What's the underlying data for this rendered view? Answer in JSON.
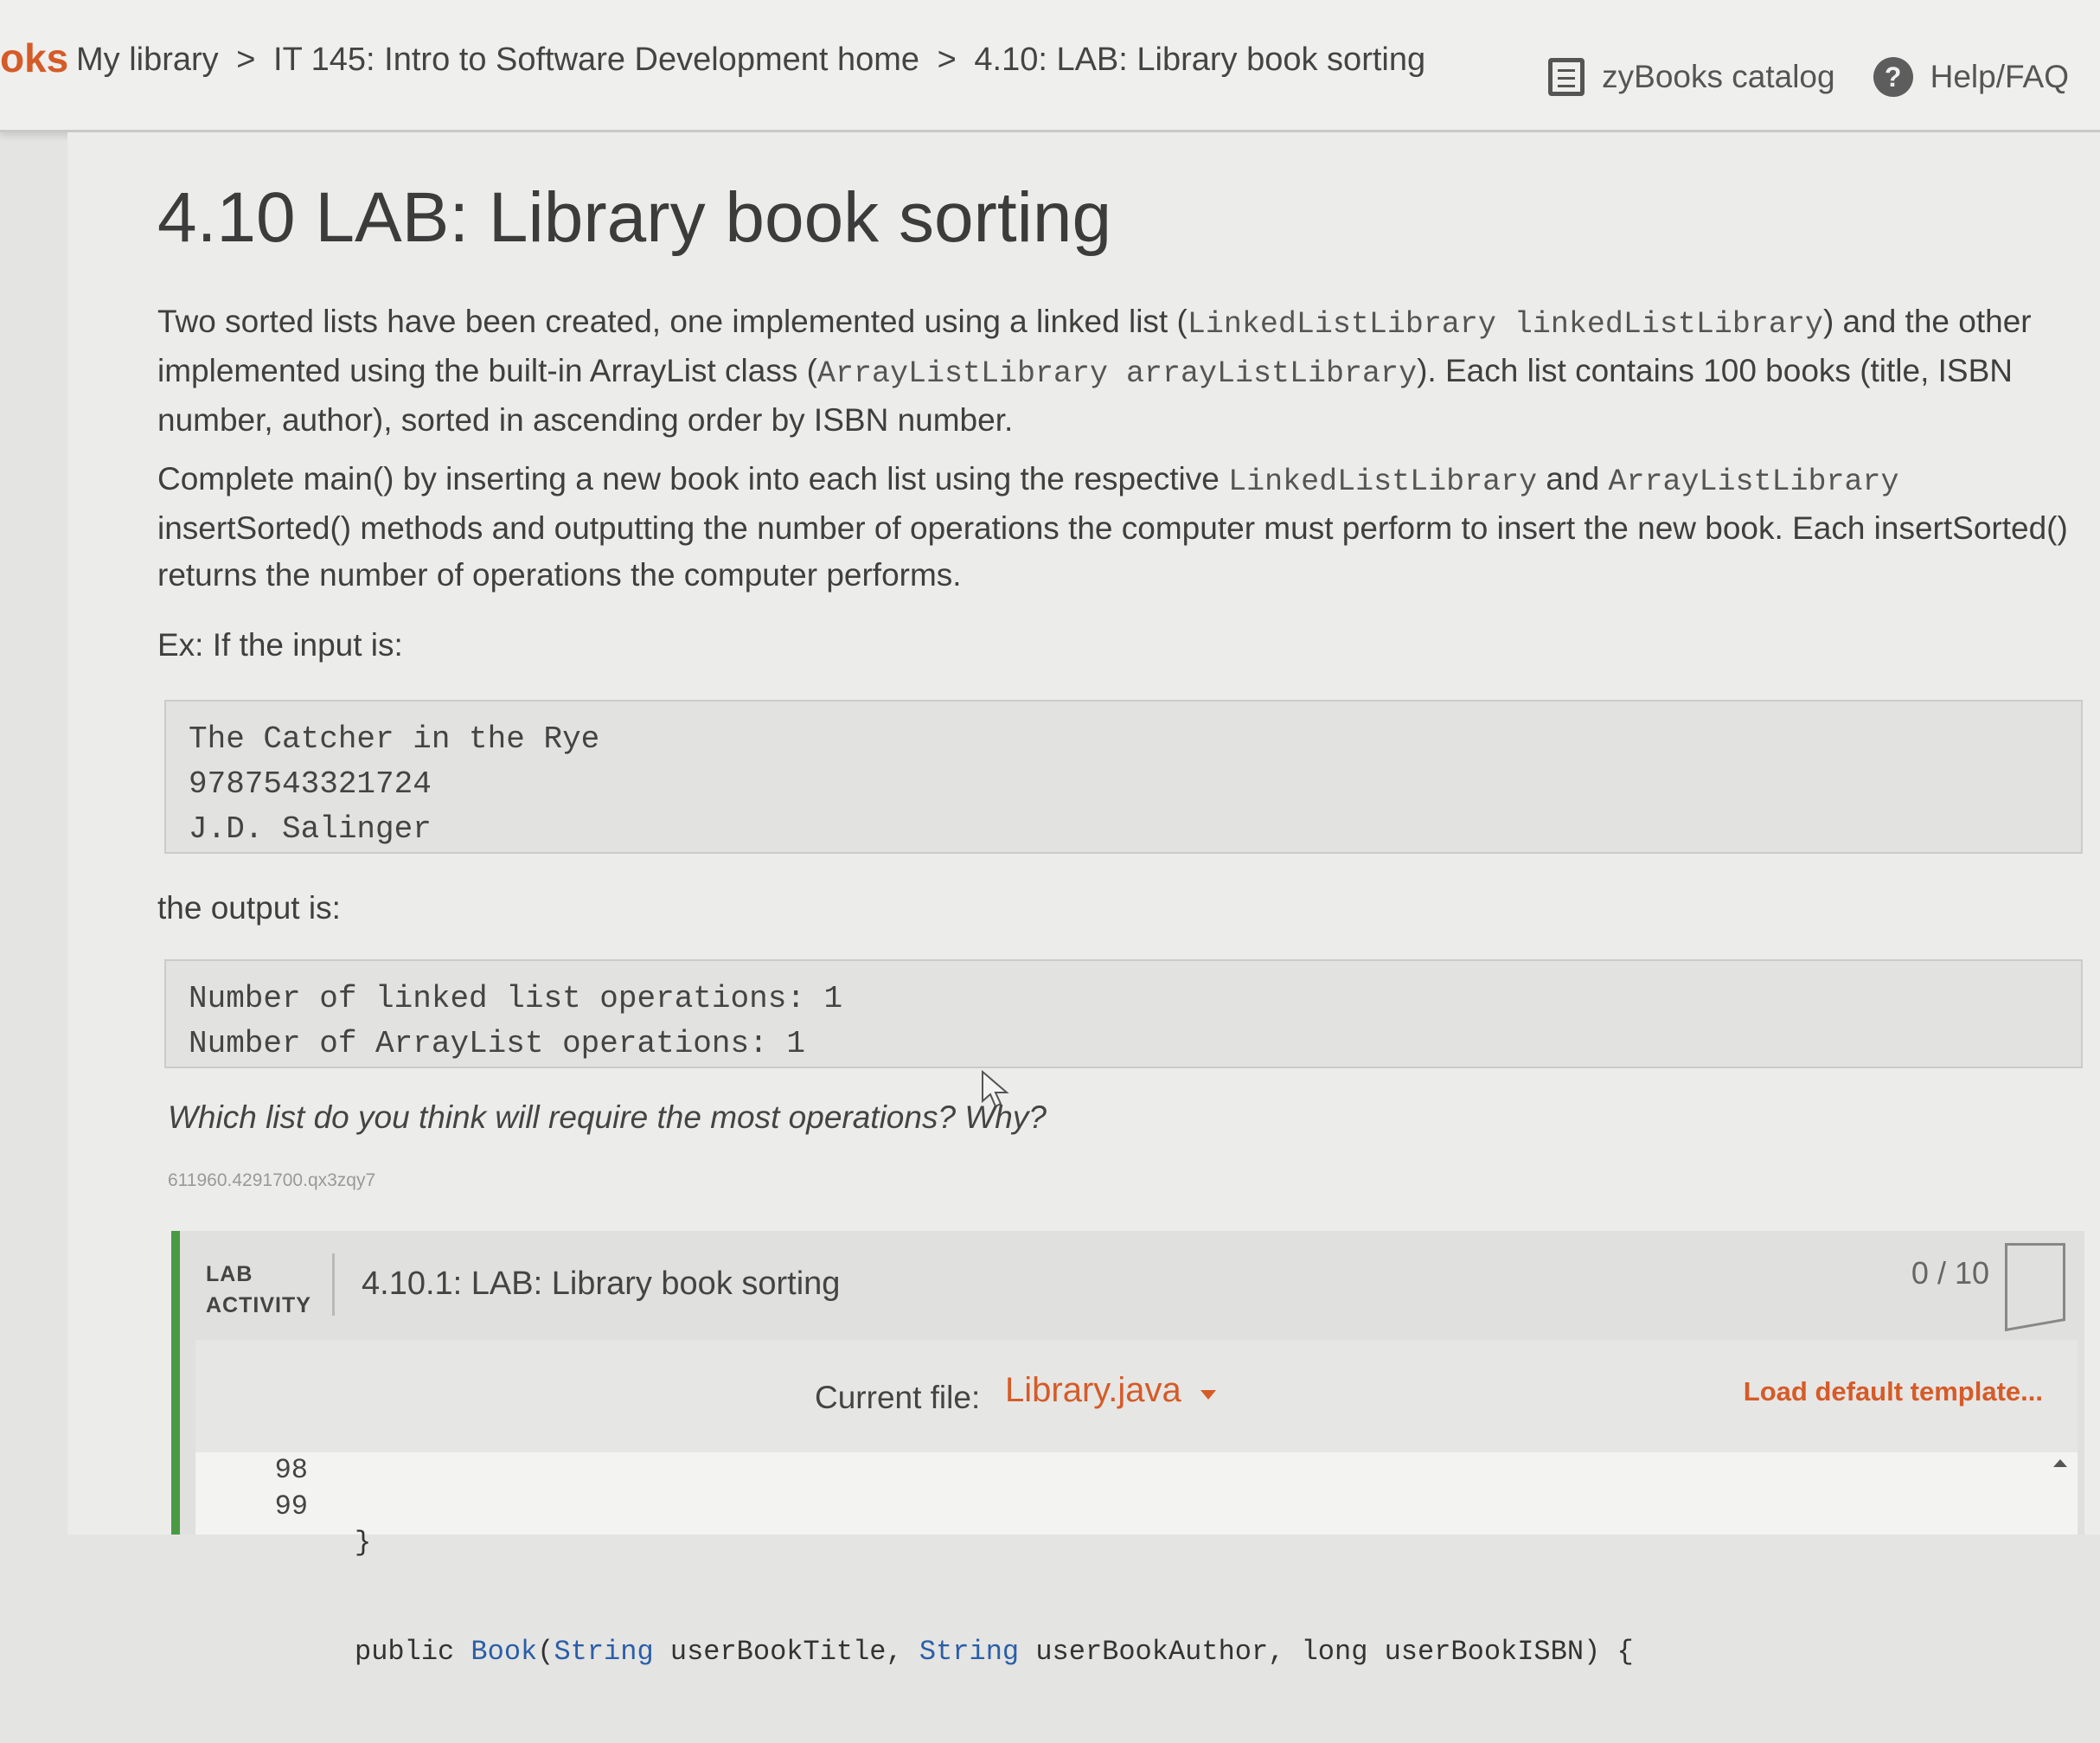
{
  "nav": {
    "brand": "oks",
    "breadcrumb": [
      "My library",
      "IT 145: Intro to Software Development home",
      "4.10: LAB: Library book sorting"
    ],
    "separator": ">",
    "catalog_label": "zyBooks catalog",
    "help_label": "Help/FAQ",
    "help_glyph": "?"
  },
  "page": {
    "title": "4.10 LAB: Library book sorting",
    "intro": {
      "t1": "Two sorted lists have been created, one implemented using a linked list (",
      "c1": "LinkedListLibrary linkedListLibrary",
      "t2": ") and the other implemented using the built-in ArrayList class (",
      "c2": "ArrayListLibrary arrayListLibrary",
      "t3": "). Each list contains 100 books (title, ISBN number, author), sorted in ascending order by ISBN number."
    },
    "task": {
      "t1": "Complete main() by inserting a new book into each list using the respective ",
      "c1": "LinkedListLibrary",
      "t2": " and ",
      "c2": "ArrayListLibrary",
      "t3": " insertSorted() methods and outputting the number of operations the computer must perform to insert the new book. Each insertSorted() returns the number of operations the computer performs."
    },
    "input_intro": "Ex: If the input is:",
    "input_lines": [
      "The Catcher in the Rye",
      "9787543321724",
      "J.D. Salinger"
    ],
    "output_intro": "the output is:",
    "output_lines": [
      "Number of linked list operations: 1",
      "Number of ArrayList operations: 1"
    ],
    "question": "Which list do you think will require the most operations? Why?",
    "tag": "611960.4291700.qx3zqy7"
  },
  "lab": {
    "label_line1": "LAB",
    "label_line2": "ACTIVITY",
    "title": "4.10.1: LAB: Library book sorting",
    "score": "0 / 10",
    "current_file_label": "Current file:",
    "current_file": "Library.java",
    "load_template": "Load default template...",
    "gutter": [
      "98",
      "99"
    ],
    "code": {
      "line1": "}",
      "l2_kw": "public ",
      "l2_ty1": "Book",
      "l2_p1": "(",
      "l2_ty2": "String",
      "l2_p2": " userBookTitle, ",
      "l2_ty3": "String",
      "l2_p3": " userBookAuthor, ",
      "l2_kw2": "long",
      "l2_p4": " userBookISBN) {"
    }
  },
  "colors": {
    "accent": "#d55b28",
    "lab_bar": "#4a9a44",
    "type_blue": "#2a5ea8"
  }
}
